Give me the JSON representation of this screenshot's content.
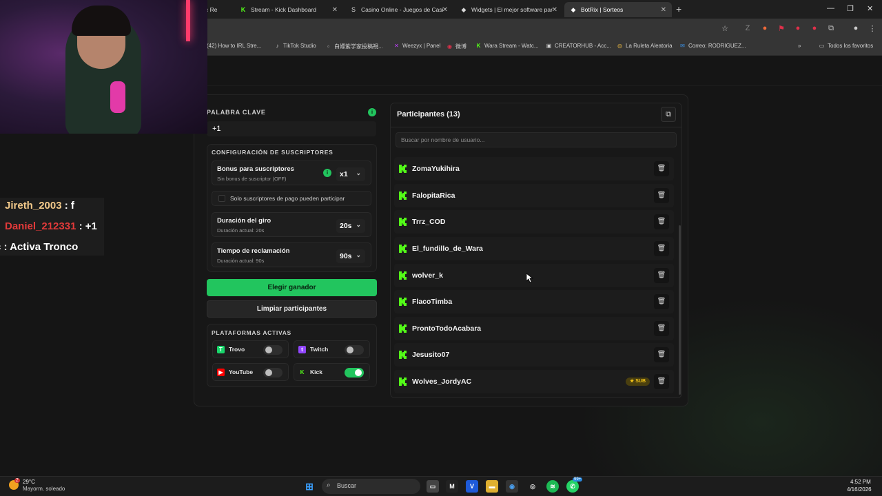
{
  "browser": {
    "tabs": [
      {
        "label": "c Re",
        "icon": "tab-partial-icon"
      },
      {
        "label": "Stream - Kick Dashboard",
        "icon": "kick-icon"
      },
      {
        "label": "Casino Online - Juegos de Casi",
        "icon": "s-icon"
      },
      {
        "label": "Widgets | El mejor software par",
        "icon": "botrix-icon"
      },
      {
        "label": "BotRix | Sorteos",
        "icon": "botrix-icon",
        "active": true
      }
    ],
    "bookmarks": [
      {
        "label": "(42) How to IRL Stre..."
      },
      {
        "label": "TikTok Studio"
      },
      {
        "label": "白嫖紫学家投稿視..."
      },
      {
        "label": "Weezyx | Panel"
      },
      {
        "label": "微博"
      },
      {
        "label": "Wara Stream - Watc..."
      },
      {
        "label": "CREATORHUB - Acc..."
      },
      {
        "label": "La Ruleta Aleatoria"
      },
      {
        "label": "Correo: RODRIGUEZ..."
      }
    ],
    "all_bookmarks": "Todos los favoritos"
  },
  "settings": {
    "keyword_label": "PALABRA CLAVE",
    "keyword_value": "+1",
    "info_glyph": "i",
    "subs_config_title": "CONFIGURACIÓN DE SUSCRIPTORES",
    "bonus": {
      "title": "Bonus para suscriptores",
      "sub": "Sin bonus de suscriptor (OFF)",
      "value": "x1"
    },
    "paid_only_label": "Solo suscriptores de pago pueden participar",
    "spin": {
      "title": "Duración del giro",
      "sub": "Duración actual: 20s",
      "value": "20s"
    },
    "claim": {
      "title": "Tiempo de reclamación",
      "sub": "Duración actual: 90s",
      "value": "90s"
    },
    "pick_winner": "Elegir ganador",
    "clear_participants": "Limpiar participantes",
    "platforms_title": "PLATAFORMAS ACTIVAS",
    "platforms": [
      {
        "name": "Trovo",
        "enabled": false,
        "color": "#19d66b"
      },
      {
        "name": "Twitch",
        "enabled": false,
        "color": "#9146ff"
      },
      {
        "name": "YouTube",
        "enabled": false,
        "color": "#ff0000"
      },
      {
        "name": "Kick",
        "enabled": true,
        "color": "#53fc18"
      }
    ]
  },
  "participants": {
    "title": "Participantes (13)",
    "search_placeholder": "Buscar por nombre de usuario...",
    "sub_badge": "★ SUB",
    "list": [
      {
        "name": "ZomaYukihira"
      },
      {
        "name": "FalopitaRica"
      },
      {
        "name": "Trrz_COD"
      },
      {
        "name": "El_fundillo_de_Wara"
      },
      {
        "name": "wolver_k"
      },
      {
        "name": "FlacoTimba"
      },
      {
        "name": "ProntoTodoAcabara"
      },
      {
        "name": "Jesusito07"
      },
      {
        "name": "Wolves_JordyAC",
        "sub": true
      }
    ]
  },
  "chat_overlay": [
    {
      "user": "Jireth_2003",
      "text": " : f",
      "color": "#f2c98a"
    },
    {
      "user": "Daniel_212331",
      "text": " : +1",
      "color": "#e23a3a"
    },
    {
      "user": "",
      "text": "c : Activa Tronco",
      "color": "#ffffff"
    }
  ],
  "taskbar": {
    "weather_temp": "29°C",
    "weather_desc": "Mayorm. soleado",
    "weather_badge": "2",
    "search": "Buscar",
    "time": "4:52 PM",
    "date": "4/16/2026",
    "notify_badge": "99+"
  },
  "colors": {
    "accent": "#22c55e",
    "kick": "#53fc18",
    "sub": "#f5c518"
  }
}
